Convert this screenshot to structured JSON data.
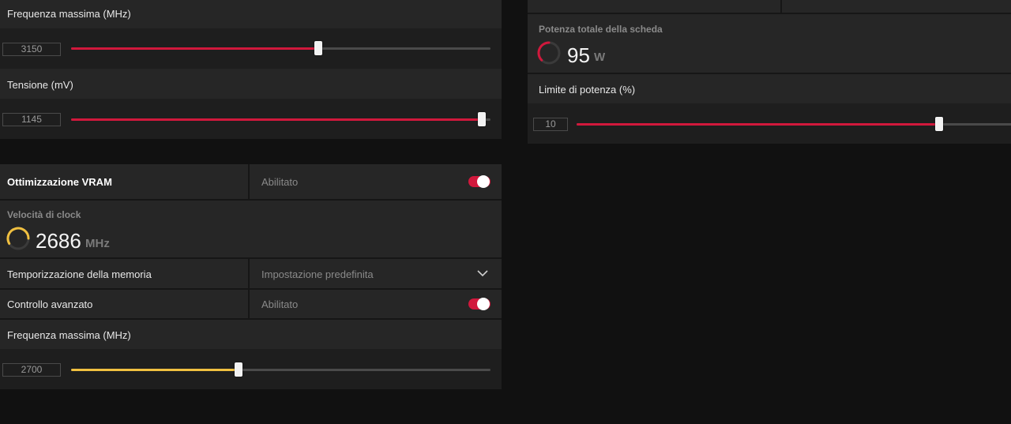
{
  "left_top": {
    "max_freq_label": "Frequenza massima (MHz)",
    "max_freq_value": "3150",
    "max_freq_fraction": 0.59,
    "voltage_label": "Tensione (mV)",
    "voltage_value": "1145",
    "voltage_fraction": 0.98
  },
  "vram": {
    "title": "Ottimizzazione VRAM",
    "status": "Abilitato",
    "toggle_on": true
  },
  "clock": {
    "title": "Velocità di clock",
    "value": "2686",
    "unit": "MHz"
  },
  "memory_timing": {
    "label": "Temporizzazione della memoria",
    "selected": "Impostazione predefinita"
  },
  "advanced": {
    "label": "Controllo avanzato",
    "status": "Abilitato",
    "toggle_on": true
  },
  "mem_max_freq": {
    "label": "Frequenza massima (MHz)",
    "value": "2700",
    "fraction": 0.4
  },
  "power": {
    "title": "Potenza totale della scheda",
    "value": "95",
    "unit": "W",
    "limit_label": "Limite di potenza (%)",
    "limit_value": "10",
    "limit_fraction": 0.82
  },
  "colors": {
    "accent_red": "#d1183c",
    "accent_yellow": "#f0c040",
    "panel": "#262626",
    "background": "#111111"
  }
}
